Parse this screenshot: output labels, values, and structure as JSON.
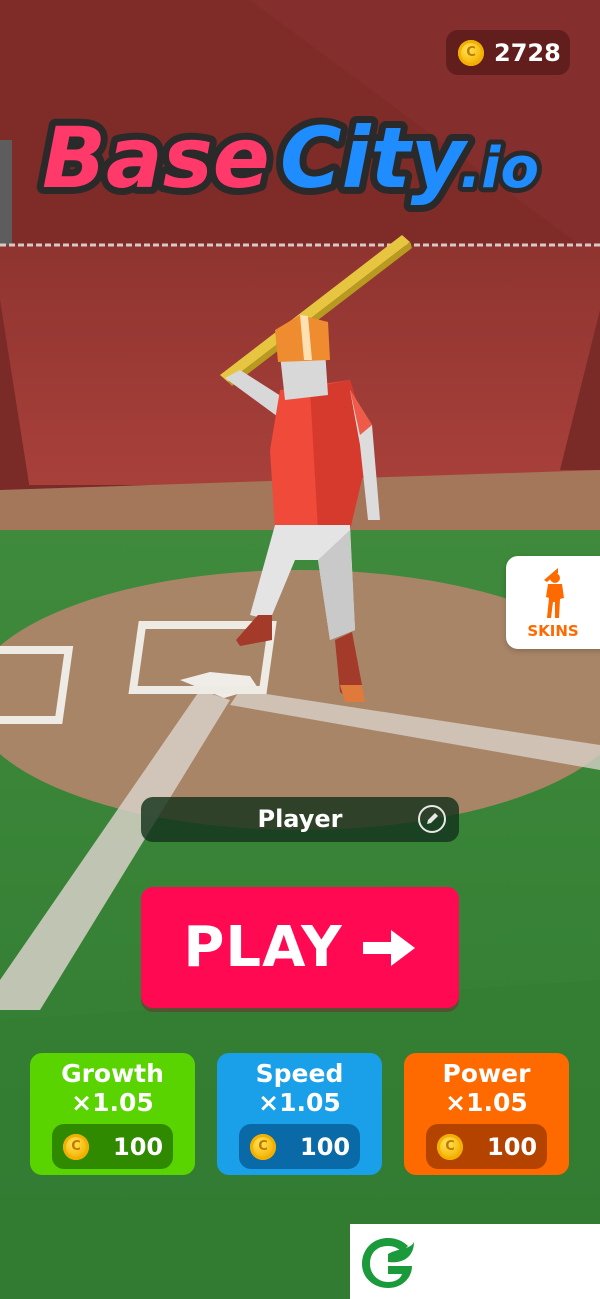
{
  "hud": {
    "coins": "2728",
    "coin_icon": "coin-icon"
  },
  "logo": {
    "part1": "Base",
    "part2": "City",
    "part3": ".io",
    "colors": {
      "part1": "#ff3a6a",
      "part2": "#1f8cff"
    }
  },
  "skins": {
    "label": "SKINS",
    "icon": "batter-silhouette-icon",
    "color": "#ff6a00"
  },
  "player": {
    "name": "Player",
    "edit_icon": "pencil-icon"
  },
  "play": {
    "label": "PLAY",
    "icon": "arrow-right-icon",
    "color": "#ff0a52"
  },
  "upgrades": [
    {
      "name": "Growth",
      "multiplier": "×1.05",
      "price": "100",
      "color": "#5ad400",
      "pill": "#2f8a00"
    },
    {
      "name": "Speed",
      "multiplier": "×1.05",
      "price": "100",
      "color": "#1aa0e8",
      "pill": "#0a6aa8"
    },
    {
      "name": "Power",
      "multiplier": "×1.05",
      "price": "100",
      "color": "#ff6a00",
      "pill": "#b54300"
    }
  ],
  "brand": {
    "icon": "leaf-g-logo-icon",
    "color": "#1a9a3a"
  }
}
